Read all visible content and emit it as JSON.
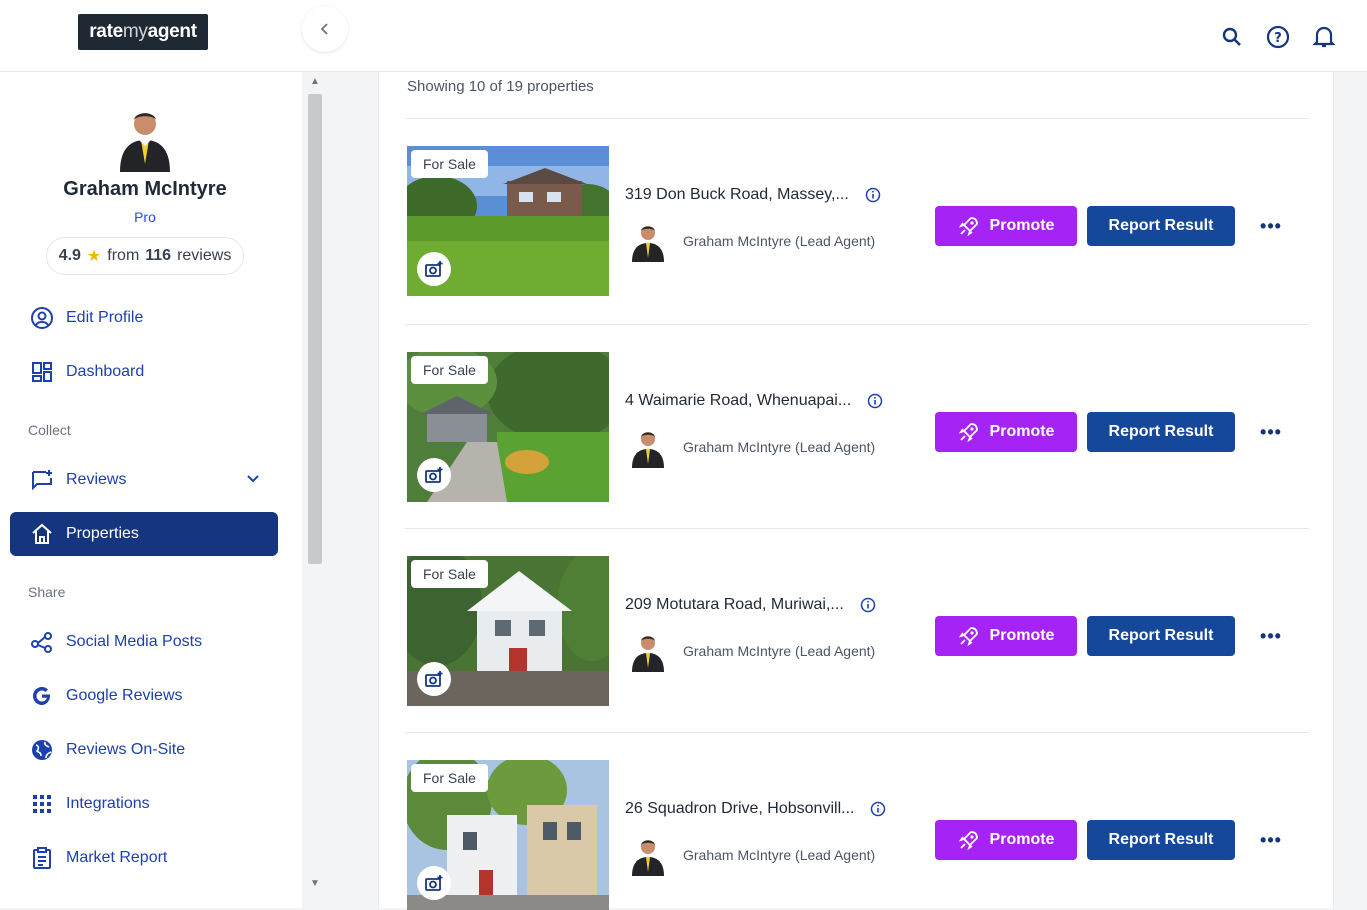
{
  "header": {
    "logo_bold": "rate",
    "logo_light": "my",
    "logo_bold2": "agent",
    "icons": [
      "search-icon",
      "help-icon",
      "bell-icon"
    ]
  },
  "sidebar": {
    "agent_name": "Graham McIntyre",
    "tier": "Pro",
    "rating": "4.9",
    "rating_text_pre": "from",
    "rating_count": "116",
    "rating_text_post": "reviews",
    "items": [
      {
        "label": "Edit Profile",
        "icon": "user-circle-icon"
      },
      {
        "label": "Dashboard",
        "icon": "dashboard-icon"
      }
    ],
    "collect_label": "Collect",
    "collect_items": [
      {
        "label": "Reviews",
        "icon": "review-icon"
      },
      {
        "label": "Properties",
        "icon": "home-icon"
      }
    ],
    "share_label": "Share",
    "share_items": [
      {
        "label": "Social Media Posts",
        "icon": "share-icon"
      },
      {
        "label": "Google Reviews",
        "icon": "google-icon"
      },
      {
        "label": "Reviews On-Site",
        "icon": "globe-icon"
      },
      {
        "label": "Integrations",
        "icon": "grid-icon"
      },
      {
        "label": "Market Report",
        "icon": "clipboard-icon"
      }
    ]
  },
  "main": {
    "showing": "Showing 10 of 19 properties",
    "properties": [
      {
        "status": "For Sale",
        "address": "319 Don Buck Road, Massey,...",
        "agent": "Graham McIntyre (Lead Agent)",
        "promote": "Promote",
        "report": "Report Result"
      },
      {
        "status": "For Sale",
        "address": "4 Waimarie Road, Whenuapai...",
        "agent": "Graham McIntyre (Lead Agent)",
        "promote": "Promote",
        "report": "Report Result"
      },
      {
        "status": "For Sale",
        "address": "209 Motutara Road, Muriwai,...",
        "agent": "Graham McIntyre (Lead Agent)",
        "promote": "Promote",
        "report": "Report Result"
      },
      {
        "status": "For Sale",
        "address": "26 Squadron Drive, Hobsonvill...",
        "agent": "Graham McIntyre (Lead Agent)",
        "promote": "Promote",
        "report": "Report Result"
      }
    ]
  },
  "colors": {
    "primary": "#15367f",
    "promote": "#a523f5",
    "report": "#15479a",
    "link": "#1e40af"
  }
}
